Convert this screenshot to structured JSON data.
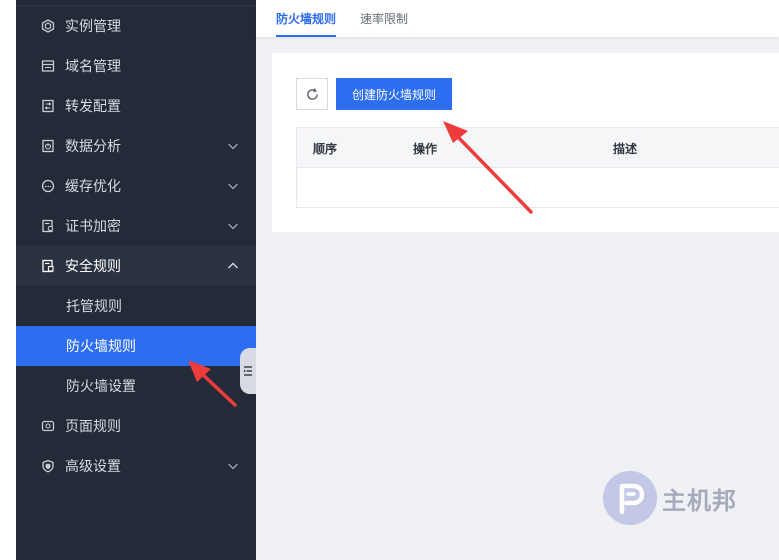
{
  "sidebar": {
    "items": [
      {
        "label": "实例管理",
        "icon": "hexagon-icon",
        "expandable": false
      },
      {
        "label": "域名管理",
        "icon": "window-icon",
        "expandable": false
      },
      {
        "label": "转发配置",
        "icon": "forward-config-icon",
        "expandable": false
      },
      {
        "label": "数据分析",
        "icon": "chart-icon",
        "expandable": true
      },
      {
        "label": "缓存优化",
        "icon": "gauge-icon",
        "expandable": true
      },
      {
        "label": "证书加密",
        "icon": "certificate-icon",
        "expandable": true
      },
      {
        "label": "安全规则",
        "icon": "security-doc-icon",
        "expandable": true,
        "open": true
      },
      {
        "label": "页面规则",
        "icon": "page-rule-icon",
        "expandable": false
      },
      {
        "label": "高级设置",
        "icon": "shield-icon",
        "expandable": true
      }
    ],
    "sub_items": [
      {
        "label": "托管规则"
      },
      {
        "label": "防火墙规则",
        "active": true
      },
      {
        "label": "防火墙设置"
      }
    ]
  },
  "tabs": [
    {
      "label": "防火墙规则",
      "active": true
    },
    {
      "label": "速率限制",
      "active": false
    }
  ],
  "toolbar": {
    "refresh_icon": "refresh-icon",
    "create_label": "创建防火墙规则"
  },
  "table": {
    "columns": [
      "顺序",
      "操作",
      "描述"
    ],
    "rows": []
  },
  "watermark": {
    "text": "主机邦"
  },
  "colors": {
    "sidebar_bg": "#232a38",
    "accent": "#2d6ef0",
    "annotation_arrow": "#ee3b3b",
    "main_bg": "#eff1f5"
  }
}
